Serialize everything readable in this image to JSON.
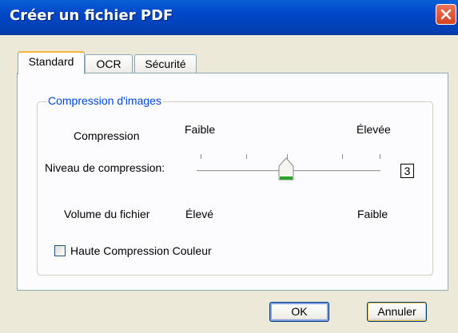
{
  "window": {
    "title": "Créer un fichier PDF"
  },
  "tabs": [
    {
      "label": "Standard",
      "active": true
    },
    {
      "label": "OCR",
      "active": false
    },
    {
      "label": "Sécurité",
      "active": false
    }
  ],
  "group": {
    "title": "Compression d'images",
    "compression_label": "Compression",
    "compression_low": "Faible",
    "compression_high": "Élevée",
    "level_label": "Niveau de compression:",
    "level_value": "3",
    "level_fraction": 0.5,
    "volume_label": "Volume du fichier",
    "volume_high": "Élevé",
    "volume_low": "Faible",
    "checkbox_label": "Haute Compression Couleur",
    "checkbox_checked": false
  },
  "buttons": {
    "ok": "OK",
    "cancel": "Annuler"
  },
  "colors": {
    "titlebar": "#0046c8",
    "group_title": "#0046d5",
    "close": "#d8431e",
    "slider_thumb_accent": "#2aa52a"
  }
}
